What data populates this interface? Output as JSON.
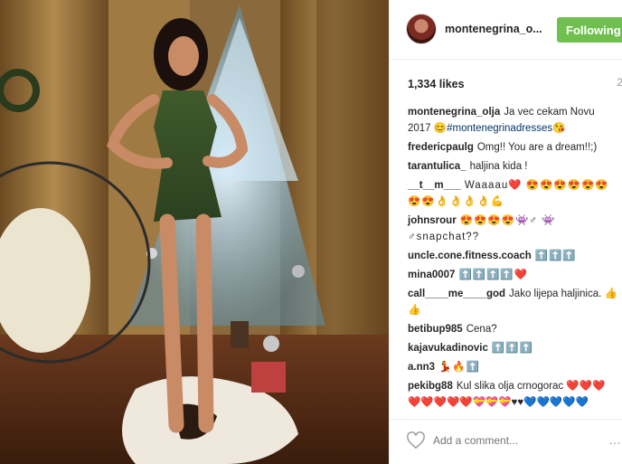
{
  "photo": {
    "alt": ""
  },
  "header": {
    "username": "montenegrina_o...",
    "follow_label": "Following",
    "follow_color": "#70c050"
  },
  "likes": {
    "count_text": "1,334 likes",
    "time_text": "2"
  },
  "comments": [
    {
      "user": "montenegrina_olja",
      "text": "Ja vec cekam Novu 2017 😊",
      "tag": "#montenegrinadresses",
      "emoji": "😘"
    },
    {
      "user": "fredericpaulg",
      "text": "Omg!! You are a dream!!;)"
    },
    {
      "user": "tarantulica_",
      "text": "haljina kida !"
    },
    {
      "user": "__t__m___",
      "text": "Waaaau❤️ 😍😍😍😍😍😍😍😍👌👌👌👌💪"
    },
    {
      "user": "johnsrour",
      "text": "😍😍😍😍👾♂ 👾♂snapchat??"
    },
    {
      "user": "uncle.cone.fitness.coach",
      "text": "⬆️⬆️⬆️"
    },
    {
      "user": "mina0007",
      "text": "⬆️⬆️⬆️⬆️❤️"
    },
    {
      "user": "call____me____god",
      "text": "Jako lijepa haljinica. 👍👍"
    },
    {
      "user": "betibup985",
      "text": "Cena?"
    },
    {
      "user": "kajavukadinovic",
      "text": "⬆️⬆️⬆️"
    },
    {
      "user": "a.nn3",
      "text": "💃🔥⬆️"
    },
    {
      "user": "pekibg88",
      "text": "Kul slika olja crnogorac ❤️❤️❤️❤️❤️❤️❤️❤️💝💝💝♥♥💙💙💙💙💙"
    }
  ],
  "footer": {
    "placeholder": "Add a comment...",
    "more_icon": "…",
    "heart_icon": "heart-outline"
  }
}
